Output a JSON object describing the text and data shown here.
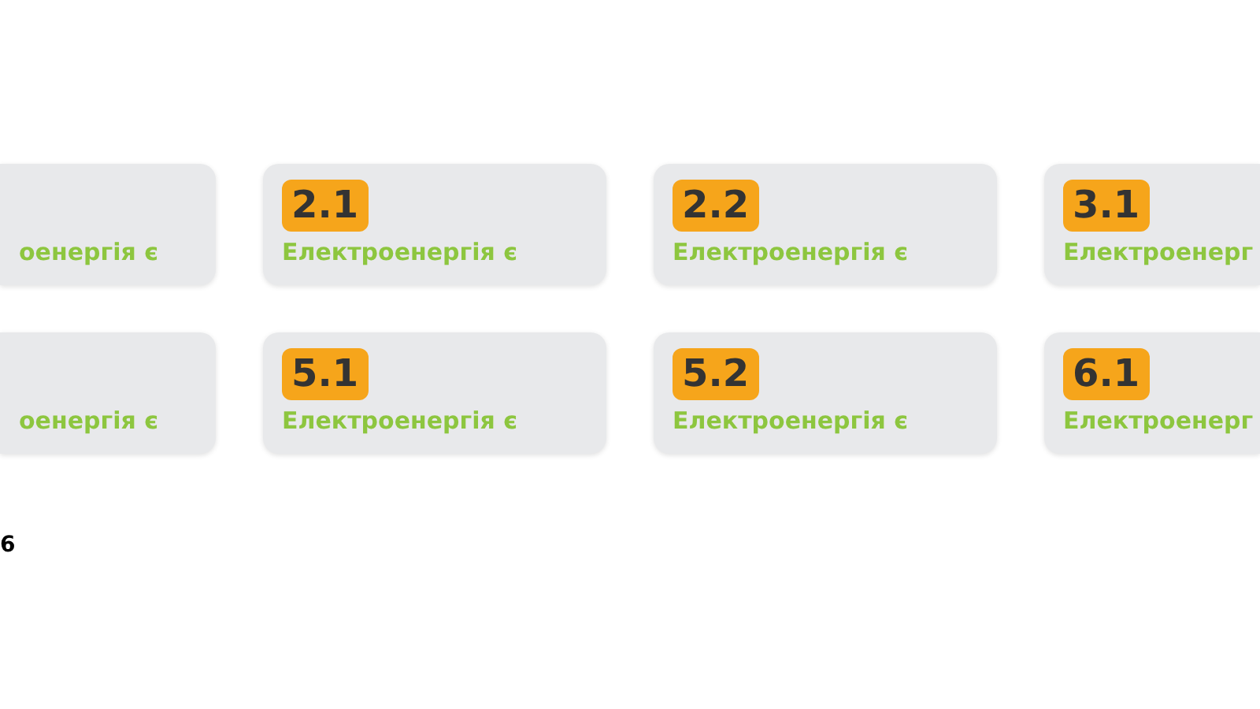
{
  "card_rows": [
    {
      "cards": [
        {
          "text": "оенергія є"
        },
        {
          "badge": "2.1",
          "text": "Електроенергія є"
        },
        {
          "badge": "2.2",
          "text": "Електроенергія є"
        },
        {
          "badge": "3.1",
          "text": "Електроенерг"
        }
      ]
    },
    {
      "cards": [
        {
          "text": "оенергія є"
        },
        {
          "badge": "5.1",
          "text": "Електроенергія є"
        },
        {
          "badge": "5.2",
          "text": "Електроенергія є"
        },
        {
          "badge": "6.1",
          "text": "Електроенерг"
        }
      ]
    }
  ],
  "footer_text": "6"
}
